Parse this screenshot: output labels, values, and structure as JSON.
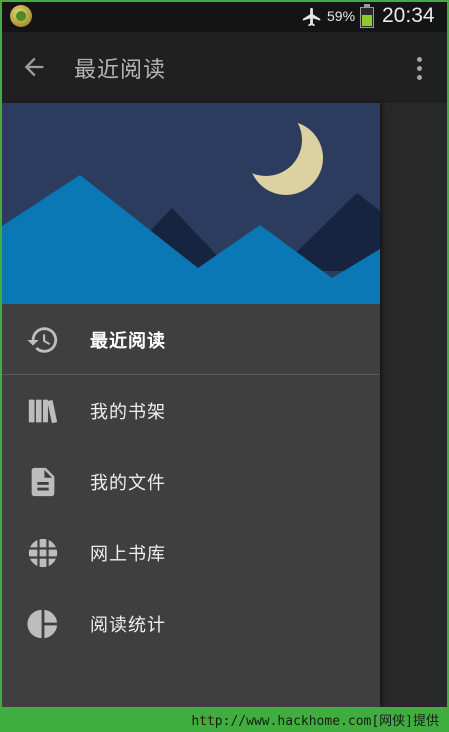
{
  "status_bar": {
    "battery_percent": "59%",
    "battery_level": 0.59,
    "time": "20:34",
    "app_icon": "notification-app-icon",
    "airplane_icon": "airplane-mode-icon"
  },
  "app_bar": {
    "title": "最近阅读",
    "back_icon": "back-arrow-icon",
    "overflow_icon": "more-vert-icon"
  },
  "drawer": {
    "header_illustration": "night-mountains-moon",
    "items": [
      {
        "label": "最近阅读",
        "icon": "history-icon",
        "active": true
      },
      {
        "label": "我的书架",
        "icon": "bookshelf-icon",
        "active": false
      },
      {
        "label": "我的文件",
        "icon": "document-icon",
        "active": false
      },
      {
        "label": "网上书库",
        "icon": "globe-icon",
        "active": false
      },
      {
        "label": "阅读统计",
        "icon": "pie-chart-icon",
        "active": false
      }
    ]
  },
  "watermark": {
    "text": "http://www.hackhome.com[网侠]提供"
  },
  "colors": {
    "header_sky": "#2c3c5e",
    "mountain_front": "#0a78b4",
    "mountain_back": "#172440",
    "moon": "#ddd1a2",
    "drawer_bg": "#3f3f3f",
    "watermark_bg": "#3fae3f"
  }
}
